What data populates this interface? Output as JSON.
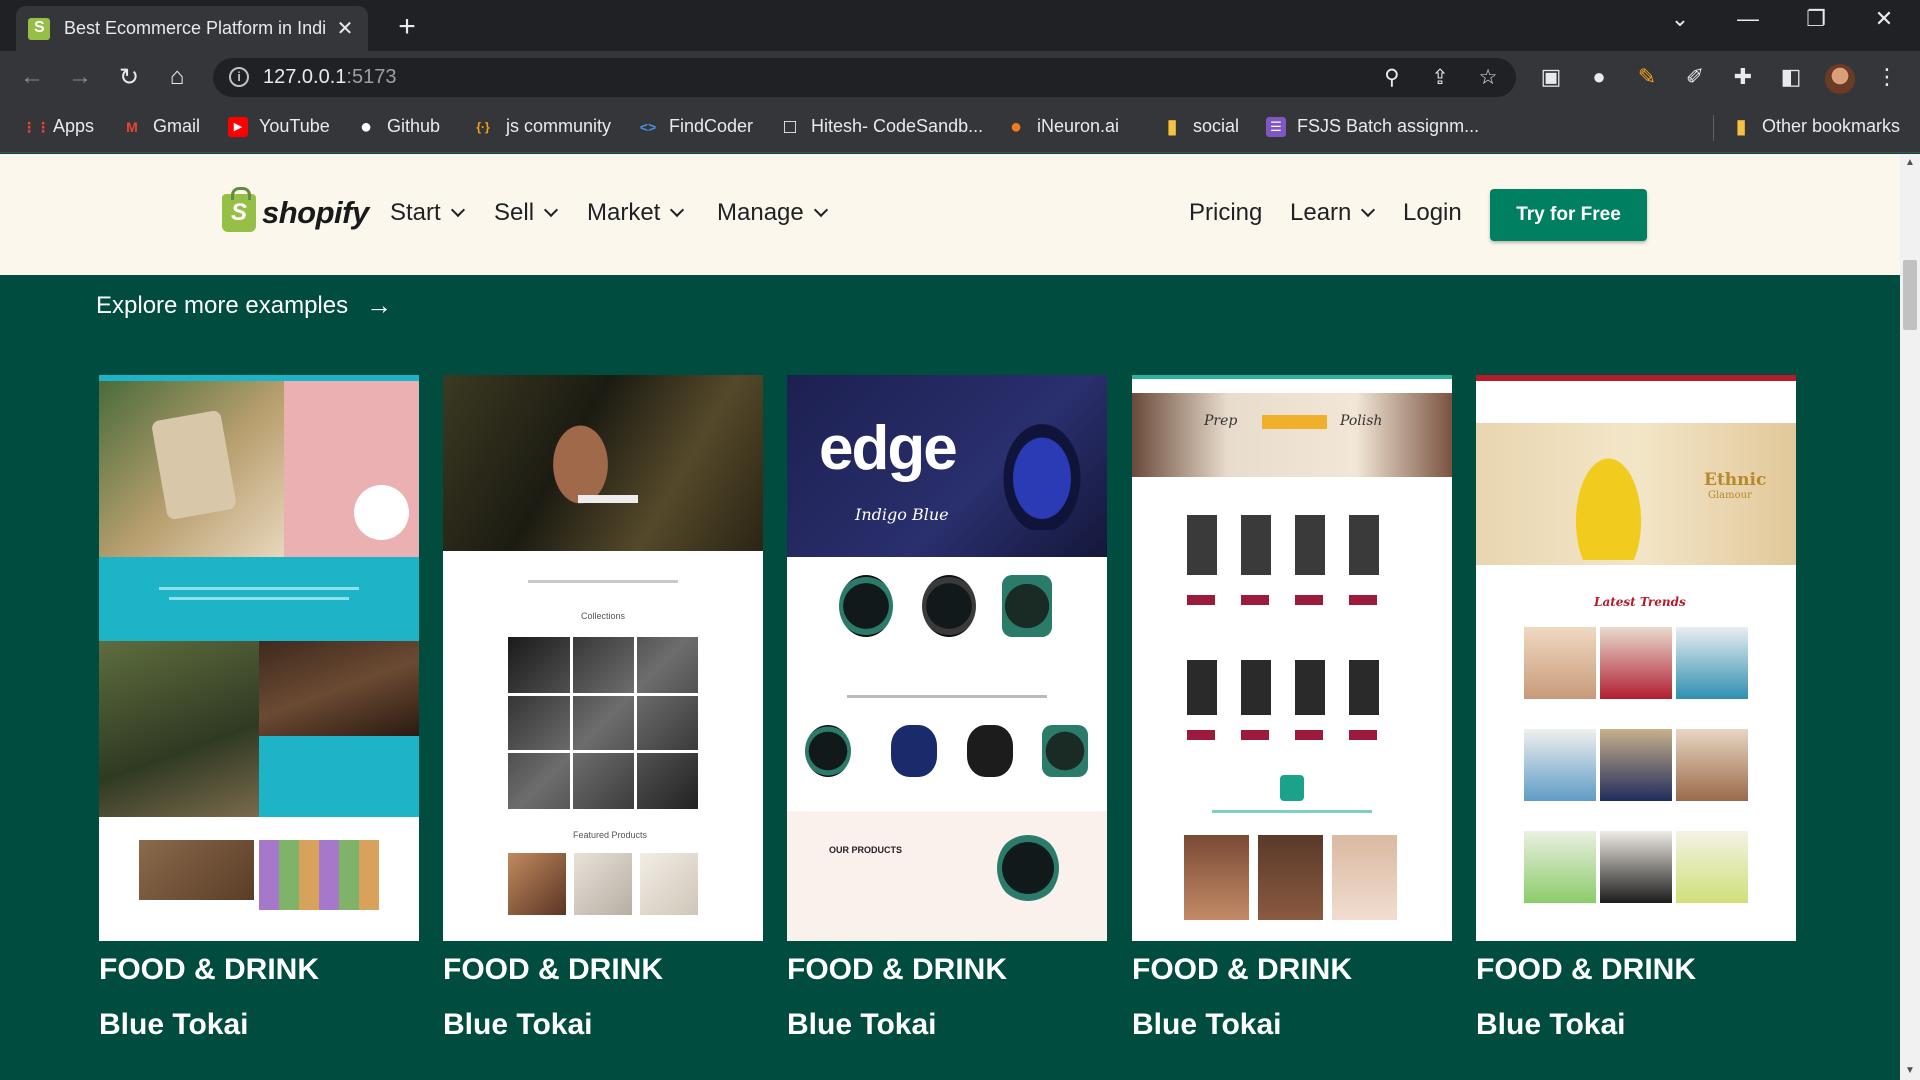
{
  "browser": {
    "tab_title": "Best Ecommerce Platform in Indi",
    "new_tab_label": "+",
    "url_host": "127.0.0.1",
    "url_port": ":5173",
    "bookmarks": [
      {
        "label": "Apps",
        "color": "#ea4335",
        "glyph": "⋮⋮"
      },
      {
        "label": "Gmail",
        "color": "#ea4335",
        "glyph": "M"
      },
      {
        "label": "YouTube",
        "color": "#ff0000",
        "glyph": "▶"
      },
      {
        "label": "Github",
        "color": "#ffffff",
        "glyph": "●"
      },
      {
        "label": "js community",
        "color": "#f4a31a",
        "glyph": "{·}"
      },
      {
        "label": "FindCoder",
        "color": "#4a90e2",
        "glyph": "<>"
      },
      {
        "label": "Hitesh- CodeSandb...",
        "color": "#ffffff",
        "glyph": "□"
      },
      {
        "label": "iNeuron.ai",
        "color": "#f27b1c",
        "glyph": "●"
      },
      {
        "label": "social",
        "color": "#f5c242",
        "glyph": "▮"
      },
      {
        "label": "FSJS Batch assignm...",
        "color": "#7e57c2",
        "glyph": "☰"
      }
    ],
    "other_bookmarks": "Other bookmarks"
  },
  "header": {
    "logo_text": "shopify",
    "nav_left": [
      "Start",
      "Sell",
      "Market",
      "Manage"
    ],
    "pricing": "Pricing",
    "learn": "Learn",
    "login": "Login",
    "cta": "Try for Free"
  },
  "section": {
    "explore_label": "Explore more examples",
    "arrow": "→"
  },
  "cards": [
    {
      "category": "FOOD & DRINK",
      "name": "Blue Tokai"
    },
    {
      "category": "FOOD & DRINK",
      "name": "Blue Tokai"
    },
    {
      "category": "FOOD & DRINK",
      "name": "Blue Tokai"
    },
    {
      "category": "FOOD & DRINK",
      "name": "Blue Tokai"
    },
    {
      "category": "FOOD & DRINK",
      "name": "Blue Tokai"
    }
  ],
  "thumbs": {
    "edge_brand": "edge",
    "edge_tag": "Indigo Blue",
    "edge_products": "OUR PRODUCTS",
    "ethnic": "Ethnic",
    "glamour": "Glamour",
    "latest_trends": "Latest Trends",
    "prep": "Prep",
    "polish": "Polish",
    "collections": "Collections",
    "featured": "Featured Products"
  },
  "colors": {
    "page_bg": "#004c3f",
    "header_bg": "#fbf7ed",
    "cta_bg": "#008060"
  }
}
